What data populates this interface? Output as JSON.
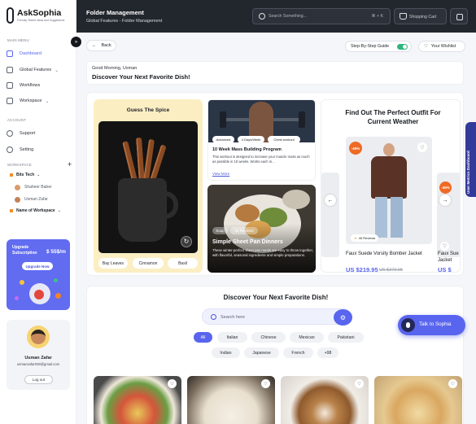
{
  "brand": {
    "name": "AskSophia",
    "tagline": "Friendly Tested Ideas and Suggestions",
    "accent": "#5965ee"
  },
  "sidebar": {
    "main_menu_label": "MAIN MENU",
    "items": [
      {
        "label": "Dashboard"
      },
      {
        "label": "Global Features"
      },
      {
        "label": "Workflows"
      },
      {
        "label": "Workspace"
      }
    ],
    "account_label": "ACCOUNT",
    "account_items": [
      {
        "label": "Support"
      },
      {
        "label": "Setting"
      }
    ],
    "workspace_label": "WORKSPACE",
    "workspaces": [
      {
        "label": "Bits Tech"
      },
      {
        "label": "Name of Workspace"
      }
    ],
    "members": [
      {
        "label": "Shaheer Baber"
      },
      {
        "label": "Usman Zafar"
      }
    ],
    "upgrade": {
      "title": "Upgrade Subscription",
      "price": "$ 55$/m",
      "button": "Upgrade Now"
    },
    "profile": {
      "name": "Usman Zafar",
      "email": "usmanzafar039@gmail.com",
      "logout": "Log out"
    }
  },
  "topbar": {
    "title": "Folder Management",
    "breadcrumb": "Global Features - Folder Management",
    "search_placeholder": "Search Something...",
    "shortcut": "⌘ + K",
    "cart_label": "Shopping Cart"
  },
  "toolbar": {
    "back": "Back",
    "guide": "Step-By-Step Guide",
    "guide_on": true,
    "wishlist": "Your Wishlist"
  },
  "greeting": {
    "line1": "Good Morning, Usman",
    "line2": "Discover Your Next Favorite Dish!"
  },
  "spice": {
    "title": "Guess The Spice",
    "options": [
      "Bay Leaves",
      "Cinnamon",
      "Basil"
    ]
  },
  "fitness": {
    "tags": [
      "Advanced",
      "4 Days/Week",
      "Chest workout"
    ],
    "title": "10 Week Mass Building Program",
    "desc": "This workout is designed to increase your muscle mass as much as possible in 10 weeks. Works each m...",
    "more": "View More"
  },
  "pan": {
    "tags": [
      "Soup",
      "48 Reviews"
    ],
    "title": "Simple Sheet Pan Dinners",
    "desc": "These winter-perfect sheet pan meals are easy to throw together, with flavorful, seasonal ingredients and simple preparations."
  },
  "outfit": {
    "title": "Find Out The Perfect Outfit For Current Weather",
    "discount": "-45%",
    "reviews": "45 Reviews",
    "name": "Faux Suede Vorsity Bomber Jacket",
    "price": "US $219.95",
    "old_price": "US $379.95",
    "name2": "Faux Sue Jacket",
    "price2": "US $"
  },
  "discover": {
    "title": "Discover Your Next Favorite Dish!",
    "search_placeholder": "Search here",
    "cuisines": [
      "All",
      "Italian",
      "Chinese",
      "Mexican",
      "Pakistani",
      "Indian",
      "Japanese",
      "French",
      "+98"
    ]
  },
  "side_tab": "User Metrics Dashboard",
  "talk_button": "Talk to Sophia"
}
